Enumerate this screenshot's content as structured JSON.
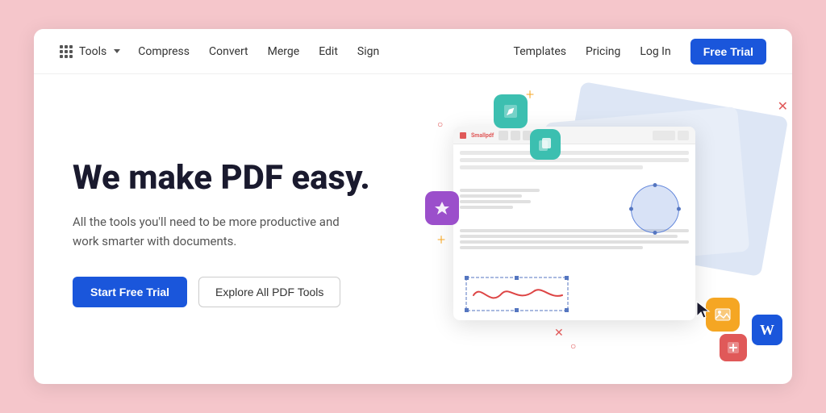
{
  "navbar": {
    "tools_label": "Tools",
    "compress_label": "Compress",
    "convert_label": "Convert",
    "merge_label": "Merge",
    "edit_label": "Edit",
    "sign_label": "Sign",
    "templates_label": "Templates",
    "pricing_label": "Pricing",
    "login_label": "Log In",
    "free_trial_label": "Free Trial"
  },
  "hero": {
    "title": "We make PDF easy.",
    "subtitle": "All the tools you'll need to be more productive and work smarter with documents.",
    "start_trial_label": "Start Free Trial",
    "explore_tools_label": "Explore All PDF Tools"
  },
  "icons": {
    "tools_grid": "grid-icon",
    "tools_chevron": "chevron-down-icon",
    "edit_icon": "pencil-icon",
    "pdf_icon": "pdf-icon",
    "duplicate_icon": "duplicate-icon",
    "stamp_icon": "stamp-icon",
    "image_icon": "image-icon",
    "word_icon": "word-icon"
  }
}
